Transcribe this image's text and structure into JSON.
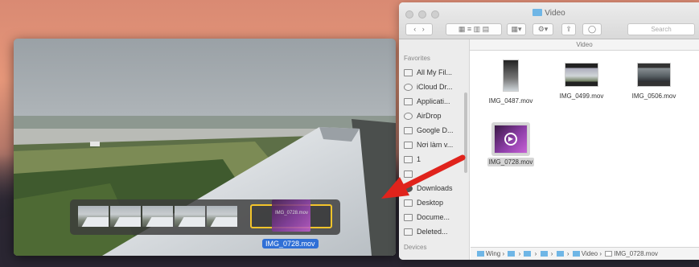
{
  "player": {
    "drag_label": "IMG_0728.mov",
    "drag_thumb_text": "IMG_0728.mov"
  },
  "finder": {
    "title": "Video",
    "path_title": "Video",
    "search_placeholder": "Search",
    "sidebar": {
      "section": "Favorites",
      "items": [
        {
          "label": "All My Fil...",
          "icon": "all-files-icon"
        },
        {
          "label": "iCloud Dr...",
          "icon": "cloud-icon"
        },
        {
          "label": "Applicati...",
          "icon": "applications-icon"
        },
        {
          "label": "AirDrop",
          "icon": "airdrop-icon"
        },
        {
          "label": "Google D...",
          "icon": "folder-icon"
        },
        {
          "label": "Nơi làm v...",
          "icon": "folder-icon"
        },
        {
          "label": "1",
          "icon": "folder-icon"
        },
        {
          "label": "",
          "icon": "folder-icon"
        },
        {
          "label": "Downloads",
          "icon": "downloads-icon"
        },
        {
          "label": "Desktop",
          "icon": "folder-icon"
        },
        {
          "label": "Docume...",
          "icon": "document-icon"
        },
        {
          "label": "Deleted...",
          "icon": "folder-icon"
        }
      ],
      "devices": "Devices"
    },
    "files": [
      {
        "name": "IMG_0487.mov"
      },
      {
        "name": "IMG_0499.mov"
      },
      {
        "name": "IMG_0506.mov"
      },
      {
        "name": "IMG_0728.mov"
      }
    ],
    "pathbar": {
      "start": "Wing",
      "end_folder": "Video",
      "end_file": "IMG_0728.mov"
    }
  }
}
